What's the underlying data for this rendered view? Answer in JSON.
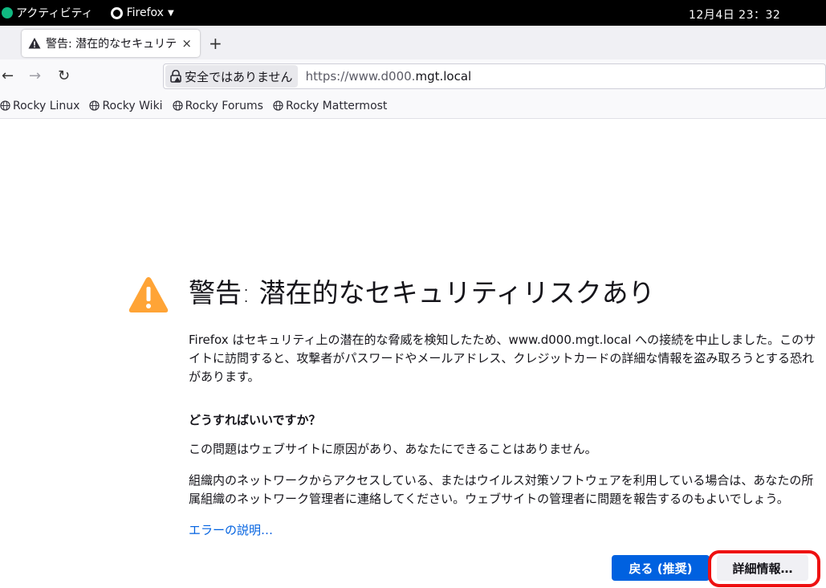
{
  "topbar": {
    "activities": "アクティビティ",
    "app_name": "Firefox",
    "clock": "12月4日  23：32"
  },
  "tab": {
    "title": "警告: 潜在的なセキュリテ",
    "close": "×",
    "new_tab": "+"
  },
  "nav": {
    "back": "←",
    "forward": "→",
    "reload": "↻",
    "identity_label": "安全ではありません",
    "url_prefix": "https://www.d000.",
    "url_domain": "mgt.local"
  },
  "bookmarks": [
    {
      "label": "Rocky Linux"
    },
    {
      "label": "Rocky Wiki"
    },
    {
      "label": "Rocky Forums"
    },
    {
      "label": "Rocky Mattermost"
    }
  ],
  "error": {
    "title": "警告: 潜在的なセキュリティリスクあり",
    "intro": "Firefox はセキュリティ上の潜在的な脅威を検知したため、www.d000.mgt.local への接続を中止しました。このサイトに訪問すると、攻撃者がパスワードやメールアドレス、クレジットカードの詳細な情報を盗み取ろうとする恐れがあります。",
    "question": "どうすればいいですか？",
    "answer1": "この問題はウェブサイトに原因があり、あなたにできることはありません。",
    "answer2": "組織内のネットワークからアクセスしている、またはウイルス対策ソフトウェアを利用している場合は、あなたの所属組織のネットワーク管理者に連絡してください。ウェブサイトの管理者に問題を報告するのもよいでしょう。",
    "explain_link": "エラーの説明…",
    "go_back_button": "戻る (推奨)",
    "advanced_button": "詳細情報…"
  },
  "colors": {
    "accent": "#0061e0",
    "warning": "#ffa436",
    "annotation": "#e11111"
  }
}
